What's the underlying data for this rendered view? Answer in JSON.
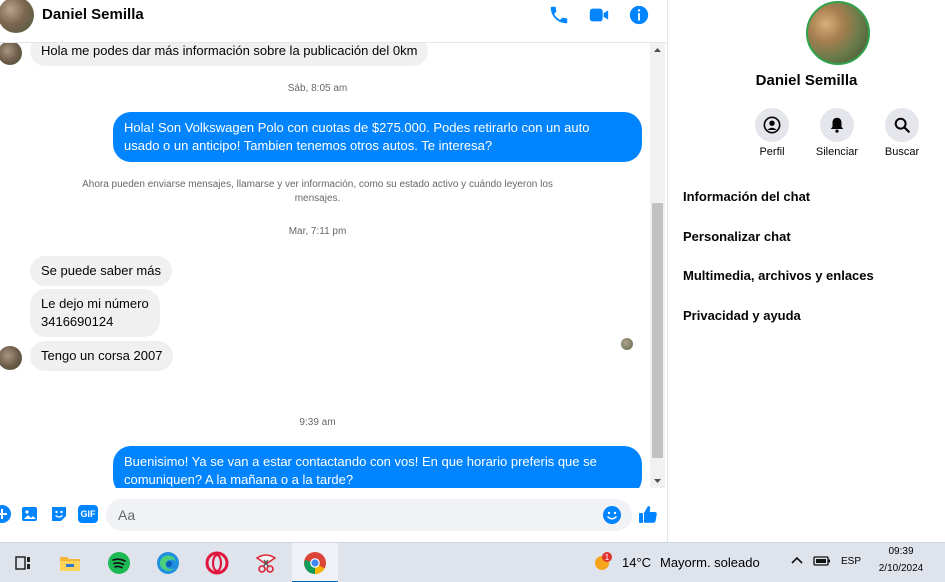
{
  "header": {
    "contact_name": "Daniel Semilla",
    "icons": [
      "phone-icon",
      "video-icon",
      "info-icon"
    ],
    "accent": "#0084ff"
  },
  "messages": {
    "first_incoming": "Hola me podes dar más información sobre la publicación del 0km",
    "timestamp_1": "Sáb, 8:05 am",
    "outgoing_1": "Hola! Son Volkswagen Polo con cuotas de $275.000. Podes retirarlo con un auto\nusado o un anticipo! Tambien tenemos otros autos. Te interesa?",
    "system_notice": "Ahora pueden enviarse mensajes, llamarse y ver información, como su estado activo\ny cuándo leyeron los mensajes.",
    "timestamp_2": "Mar, 7:11 pm",
    "incoming_2": "Se puede saber más",
    "incoming_3": "Le dejo mi número\n3416690124",
    "incoming_4": "Tengo un corsa 2007",
    "timestamp_3": "9:39 am",
    "outgoing_2": "Buenisimo! Ya se van a estar contactando con vos! En que horario preferis que se\ncomuniquen? A la mañana o a la tarde?"
  },
  "composer": {
    "placeholder": "Aa",
    "icons": [
      "add-icon",
      "image-icon",
      "sticker-icon",
      "gif-icon",
      "emoji-icon",
      "like-icon"
    ],
    "gif_label": "GIF"
  },
  "profile": {
    "name": "Daniel Semilla",
    "actions": [
      {
        "label": "Perfil",
        "icon": "profile-icon"
      },
      {
        "label": "Silenciar",
        "icon": "bell-icon"
      },
      {
        "label": "Buscar",
        "icon": "search-icon"
      }
    ],
    "menu": [
      "Información del chat",
      "Personalizar chat",
      "Multimedia, archivos y enlaces",
      "Privacidad y ayuda"
    ]
  },
  "taskbar": {
    "apps": [
      "task-view-icon",
      "file-explorer-icon",
      "spotify-icon",
      "edge-icon",
      "opera-icon",
      "snipping-tool-icon",
      "chrome-icon"
    ],
    "weather_badge": "1",
    "temperature": "14°C",
    "weather": "Mayorm. soleado",
    "language": "ESP",
    "time": "09:39",
    "date": "2/10/2024"
  }
}
